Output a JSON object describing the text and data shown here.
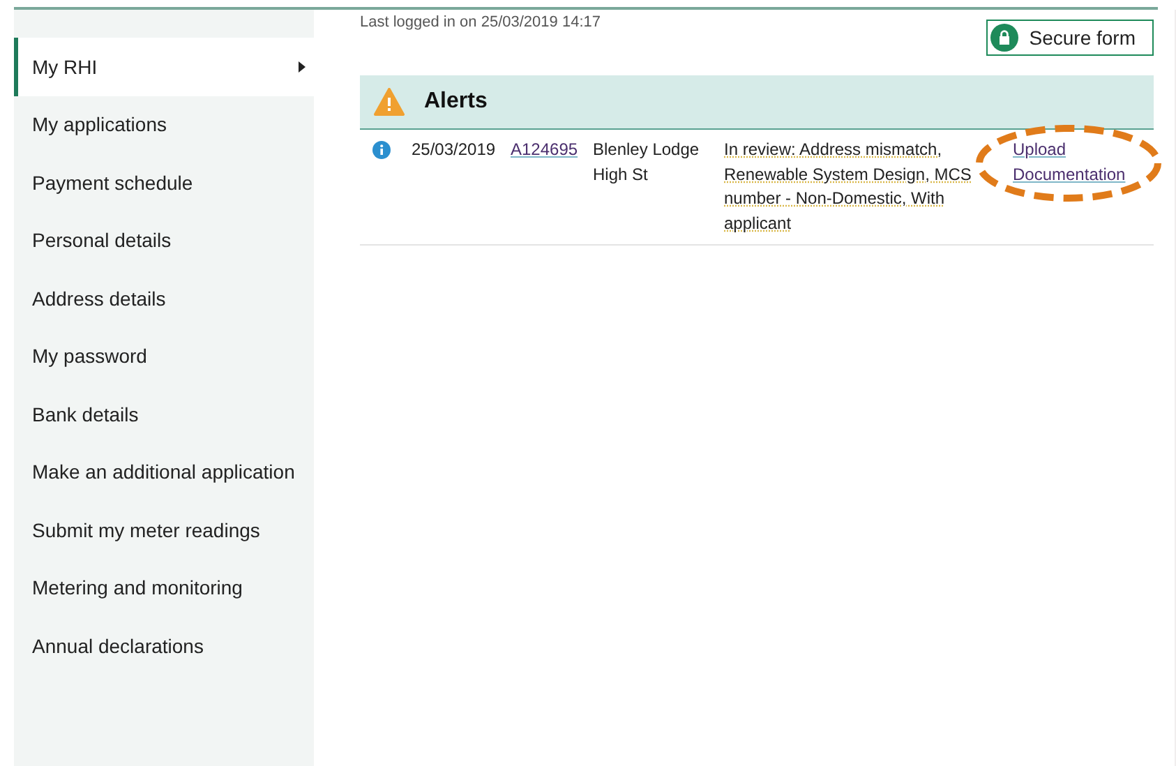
{
  "sidebar": {
    "items": [
      {
        "label": "My RHI",
        "selected": true,
        "expandable": true
      },
      {
        "label": "My applications",
        "selected": false,
        "expandable": false
      },
      {
        "label": "Payment schedule",
        "selected": false,
        "expandable": false
      },
      {
        "label": "Personal details",
        "selected": false,
        "expandable": false
      },
      {
        "label": "Address details",
        "selected": false,
        "expandable": false
      },
      {
        "label": "My password",
        "selected": false,
        "expandable": false
      },
      {
        "label": "Bank details",
        "selected": false,
        "expandable": false
      },
      {
        "label": "Make an additional application",
        "selected": false,
        "expandable": false
      },
      {
        "label": "Submit my meter readings",
        "selected": false,
        "expandable": false
      },
      {
        "label": "Metering and monitoring",
        "selected": false,
        "expandable": false
      },
      {
        "label": "Annual declarations",
        "selected": false,
        "expandable": false
      }
    ]
  },
  "last_login": "Last logged in on 25/03/2019 14:17",
  "secure_badge": "Secure form",
  "alerts": {
    "title": "Alerts",
    "rows": [
      {
        "date": "25/03/2019",
        "reference": "A124695",
        "address": "Blenley Lodge High St",
        "status": "In review: Address mismatch, Renewable System Design, MCS number - Non-Domestic, With applicant",
        "action": "Upload Documentation",
        "highlighted": true
      }
    ]
  }
}
